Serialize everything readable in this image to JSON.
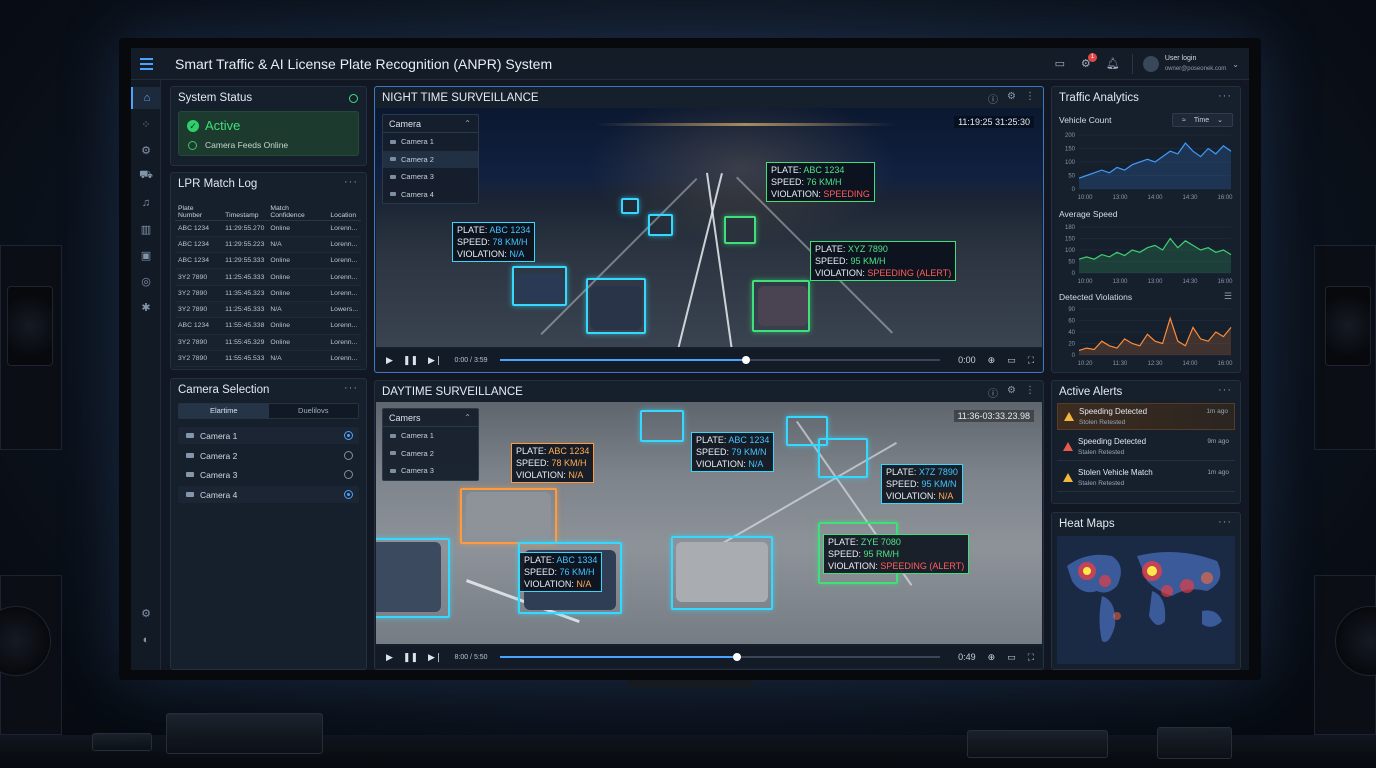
{
  "app": {
    "title": "Smart Traffic & AI License Plate Recognition (ANPR) System"
  },
  "header": {
    "notif_count": "1",
    "user_name": "User login",
    "user_email": "owner@poseonek.com"
  },
  "sidebar": {
    "icons": [
      "home-icon",
      "grid-icon",
      "settings-cog-icon",
      "car-icon",
      "bell-icon",
      "bar-chart-icon",
      "video-icon",
      "globe-icon",
      "gear-icon"
    ],
    "bottom_icons": [
      "settings-icon",
      "help-icon"
    ]
  },
  "system_status": {
    "title": "System Status",
    "state": "Active",
    "subtitle": "Camera Feeds Online"
  },
  "lpr_log": {
    "title": "LPR Match Log",
    "columns": [
      "Plate Number",
      "Timestamp",
      "Match Confidence",
      "Location"
    ],
    "rows": [
      [
        "ABC 1234",
        "11:29:55.270",
        "Online",
        "Lorenn..."
      ],
      [
        "ABC 1234",
        "11:29:55.223",
        "N/A",
        "Lorenn..."
      ],
      [
        "ABC 1234",
        "11:29:55.333",
        "Online",
        "Lorenn..."
      ],
      [
        "3Y2 7890",
        "11:25:45.333",
        "Online",
        "Lorenn..."
      ],
      [
        "3Y2 7890",
        "11:35:45.323",
        "Online",
        "Lorenn..."
      ],
      [
        "3Y2 7890",
        "11:25:45.333",
        "N/A",
        "Lowers..."
      ],
      [
        "ABC 1234",
        "11:55:45.338",
        "Online",
        "Lorenn..."
      ],
      [
        "3Y2 7890",
        "11:55:45.329",
        "Online",
        "Lorenn..."
      ],
      [
        "3Y2 7890",
        "11:55:45.533",
        "N/A",
        "Lorenn..."
      ]
    ]
  },
  "camera_selection": {
    "title": "Camera Selection",
    "tabs": [
      "Elartime",
      "Duelilovs"
    ],
    "cameras": [
      {
        "label": "Camera 1",
        "selected": true
      },
      {
        "label": "Camera 2",
        "selected": false
      },
      {
        "label": "Camera 3",
        "selected": false
      },
      {
        "label": "Camera 4",
        "selected": true
      }
    ]
  },
  "night": {
    "title": "NIGHT TIME SURVEILLANCE",
    "timestamp": "11:19:25 31:25:30",
    "dropdown_header": "Camera",
    "cameras": [
      "Camera 1",
      "Camera 2",
      "Camera 3",
      "Camera 4"
    ],
    "selected_camera": 1,
    "labels": [
      {
        "plate": "ABC 1234",
        "speed": "78 KM/H",
        "violation": "N/A"
      },
      {
        "plate": "ABC 1234",
        "speed": "76 KM/H",
        "violation": "SPEEDING"
      },
      {
        "plate": "XYZ 7890",
        "speed": "95 KM/H",
        "violation": "SPEEDING (ALERT)"
      }
    ],
    "time": "0:00 / 3:59",
    "end_time": "0:00",
    "progress": 0.56
  },
  "day": {
    "title": "DAYTIME SURVEILLANCE",
    "timestamp": "11:36-03:33.23.98",
    "dropdown_header": "Camers",
    "cameras": [
      "Camera 1",
      "Camera 2",
      "Camera 3"
    ],
    "labels": [
      {
        "plate": "ABC 1234",
        "speed": "78 KM/H",
        "violation": "N/A"
      },
      {
        "plate": "ABC 1234",
        "speed": "79 KM/N",
        "violation": "N/A"
      },
      {
        "plate": "X7Z 7890",
        "speed": "95 KM/N",
        "violation": "N/A"
      },
      {
        "plate": "ABC 1334",
        "speed": "76 KM/H",
        "violation": "N/A"
      },
      {
        "plate": "ZYE 7080",
        "speed": "95 RM/H",
        "violation": "SPEEDING (ALERT)"
      }
    ],
    "time": "8:00 / 5:50",
    "end_time": "0:49",
    "progress": 0.54
  },
  "analytics": {
    "title": "Traffic Analytics",
    "dropdown": "Time",
    "charts": [
      {
        "title": "Vehicle Count",
        "y_ticks": [
          "200",
          "150",
          "100",
          "50",
          "0"
        ],
        "x_ticks": [
          "10:00",
          "13:00",
          "14:00",
          "14:30",
          "16:00"
        ],
        "color": "#3d9bff"
      },
      {
        "title": "Average Speed",
        "y_ticks": [
          "180",
          "150",
          "100",
          "50",
          "0"
        ],
        "x_ticks": [
          "10:00",
          "13:00",
          "13:00",
          "14:30",
          "16:00"
        ],
        "color": "#3fd072"
      },
      {
        "title": "Detected Violations",
        "y_ticks": [
          "90",
          "60",
          "40",
          "20",
          "0"
        ],
        "x_ticks": [
          "10:20",
          "11:30",
          "12:30",
          "14:00",
          "16:00"
        ],
        "color": "#ff8c3a"
      }
    ]
  },
  "alerts": {
    "title": "Active Alerts",
    "items": [
      {
        "title": "Speeding Detected",
        "sub": "Stolen Retested",
        "ago": "1m ago",
        "level": "warn"
      },
      {
        "title": "Speeding Detected",
        "sub": "Stalen Retested",
        "ago": "9m ago",
        "level": "danger"
      },
      {
        "title": "Stolen Vehicle Match",
        "sub": "Stalen Retested",
        "ago": "1m ago",
        "level": "warn"
      }
    ]
  },
  "heatmap": {
    "title": "Heat Maps"
  }
}
